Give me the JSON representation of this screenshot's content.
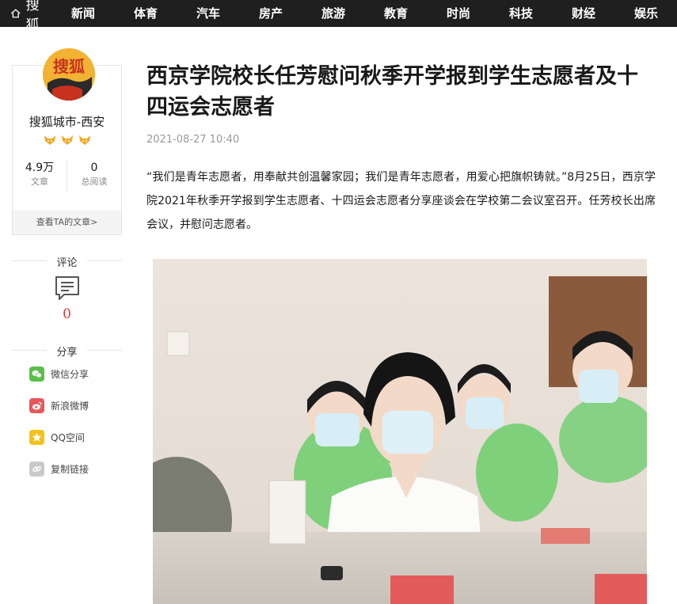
{
  "brand": {
    "logo_text": "搜狐",
    "home_icon": "home-icon"
  },
  "nav": {
    "items": [
      "新闻",
      "体育",
      "汽车",
      "房产",
      "旅游",
      "教育",
      "时尚",
      "科技",
      "财经",
      "娱乐"
    ]
  },
  "author": {
    "avatar_text": "搜狐",
    "name": "搜狐城市-西安",
    "badges": [
      "fox-badge",
      "fox-badge",
      "fox-badge"
    ],
    "articles_count": "4.9万",
    "articles_label": "文章",
    "reads_count": "0",
    "reads_label": "总阅读",
    "view_articles_link": "查看TA的文章>"
  },
  "comment": {
    "heading": "评论",
    "count": "0"
  },
  "share": {
    "heading": "分享",
    "items": [
      {
        "label": "微信分享",
        "icon": "wechat-icon",
        "color": "#5bbf4a"
      },
      {
        "label": "新浪微博",
        "icon": "weibo-icon",
        "color": "#e8575a"
      },
      {
        "label": "QQ空间",
        "icon": "qzone-icon",
        "color": "#f3c21a"
      },
      {
        "label": "复制链接",
        "icon": "link-icon",
        "color": "#c9c9c9"
      }
    ]
  },
  "article": {
    "title": "西京学院校长任芳慰问秋季开学报到学生志愿者及十四运会志愿者",
    "date": "2021-08-27 10:40",
    "body": "“我们是青年志愿者，用奉献共创温馨家园；我们是青年志愿者，用爱心把旗帜铸就。”8月25日，西京学院2021年秋季开学报到学生志愿者、十四运会志愿者分享座谈会在学校第二会议室召开。任芳校长出席会议，并慰问志愿者。"
  },
  "colors": {
    "nav_bg": "#1f1f1f",
    "accent_red": "#e53935",
    "uniform_green": "#7fd07a"
  }
}
